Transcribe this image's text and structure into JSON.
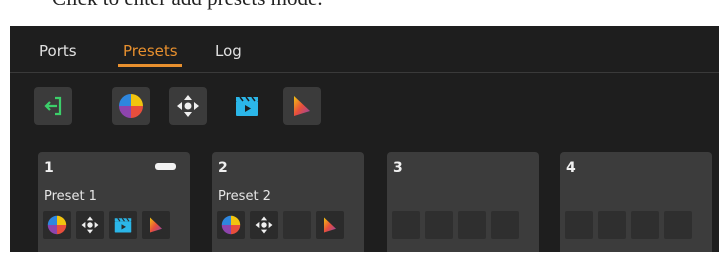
{
  "caption": "Click to enter add presets mode.",
  "tabs": [
    {
      "label": "Ports",
      "active": false
    },
    {
      "label": "Presets",
      "active": true
    },
    {
      "label": "Log",
      "active": false
    }
  ],
  "colors": {
    "accent": "#e8902e",
    "exit_green": "#3ccf6a",
    "panel_bg": "#1e1e1e",
    "card_bg": "#3c3c3c"
  },
  "toolbar": {
    "icons": [
      "exit-icon",
      "color-wheel-icon",
      "move-arrows-icon",
      "clapper-icon",
      "gradient-triangle-icon"
    ]
  },
  "presets": [
    {
      "number": "1",
      "name": "Preset 1",
      "selected": true,
      "slots": [
        "color-wheel-icon",
        "move-arrows-icon",
        "clapper-icon",
        "gradient-triangle-icon"
      ]
    },
    {
      "number": "2",
      "name": "Preset 2",
      "selected": false,
      "slots": [
        "color-wheel-icon",
        "move-arrows-icon",
        "",
        "gradient-triangle-icon"
      ]
    },
    {
      "number": "3",
      "name": "",
      "selected": false,
      "slots": [
        "",
        "",
        "",
        ""
      ]
    },
    {
      "number": "4",
      "name": "",
      "selected": false,
      "slots": [
        "",
        "",
        "",
        ""
      ]
    }
  ]
}
